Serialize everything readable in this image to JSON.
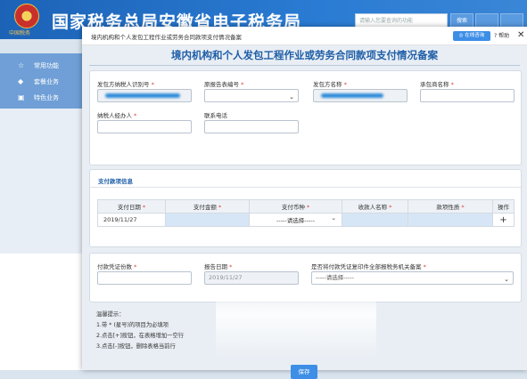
{
  "portal": {
    "title": "国家税务总局安徽省电子税务局",
    "emblem_caption": "中国税务",
    "search_placeholder": "请输入您要查询的功能",
    "btn1": "搜索",
    "btn2": "",
    "btn3": ""
  },
  "sidebar": {
    "items": [
      {
        "icon": "☆",
        "label": "常用功能"
      },
      {
        "icon": "◆",
        "label": "套餐业务"
      },
      {
        "icon": "▣",
        "label": "特色业务"
      }
    ]
  },
  "modal": {
    "title": "境内机构和个人发包工程作业或劳务合同款项支付情况备案",
    "online_consult": "在线咨询",
    "help": "帮助",
    "close": "✕"
  },
  "form": {
    "heading": "境内机构和个人发包工程作业或劳务合同款项支付情况备案",
    "payer_taxid_label": "发包方纳税人识别号",
    "orig_form_no_label": "原报告表编号",
    "payer_name_label": "发包方名称",
    "contractor_label": "承包商名称",
    "handler_label": "纳税人经办人",
    "phone_label": "联系电话",
    "required_mark": "*"
  },
  "payment": {
    "section_title": "支付款项信息",
    "columns": [
      "支付日期",
      "支付金额",
      "支付币种",
      "收款人名称",
      "款项性质",
      "操作"
    ],
    "row": {
      "date": "2019/11/27",
      "amount": "",
      "currency": "-----请选择-----",
      "payee": "",
      "nature": "",
      "op": "+"
    }
  },
  "voucher": {
    "count_label": "付款凭证份数",
    "report_date_label": "报告日期",
    "report_date_value": "2019/11/27",
    "filed_label": "是否将付款凭证复印件全部报税务机关备案",
    "filed_value": "-----请选择-----"
  },
  "tips": {
    "title": "温馨提示：",
    "line1": "1.带 * (星号)的项目为必填项",
    "line2": "2.点击[+]按钮，在表格增加一空行",
    "line3": "3.点击[-]按钮，删除表格当前行"
  },
  "save_label": "保存",
  "colors": {
    "accent": "#3d8ee6",
    "heading": "#1f5fa8",
    "required": "#e23b3b",
    "header_bg": "#1c63b7"
  }
}
